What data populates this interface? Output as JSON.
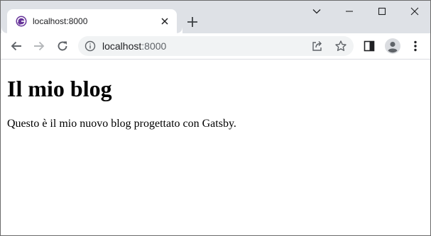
{
  "browser": {
    "tab": {
      "title": "localhost:8000",
      "favicon": "gatsby-icon"
    },
    "address_bar": {
      "host": "localhost",
      "port": ":8000"
    },
    "colors": {
      "tabstrip": "#dee1e6",
      "favicon": "#663399",
      "icon": "#5f6368"
    }
  },
  "page": {
    "heading": "Il mio blog",
    "paragraph": "Questo è il mio nuovo blog progettato con Gatsby."
  }
}
